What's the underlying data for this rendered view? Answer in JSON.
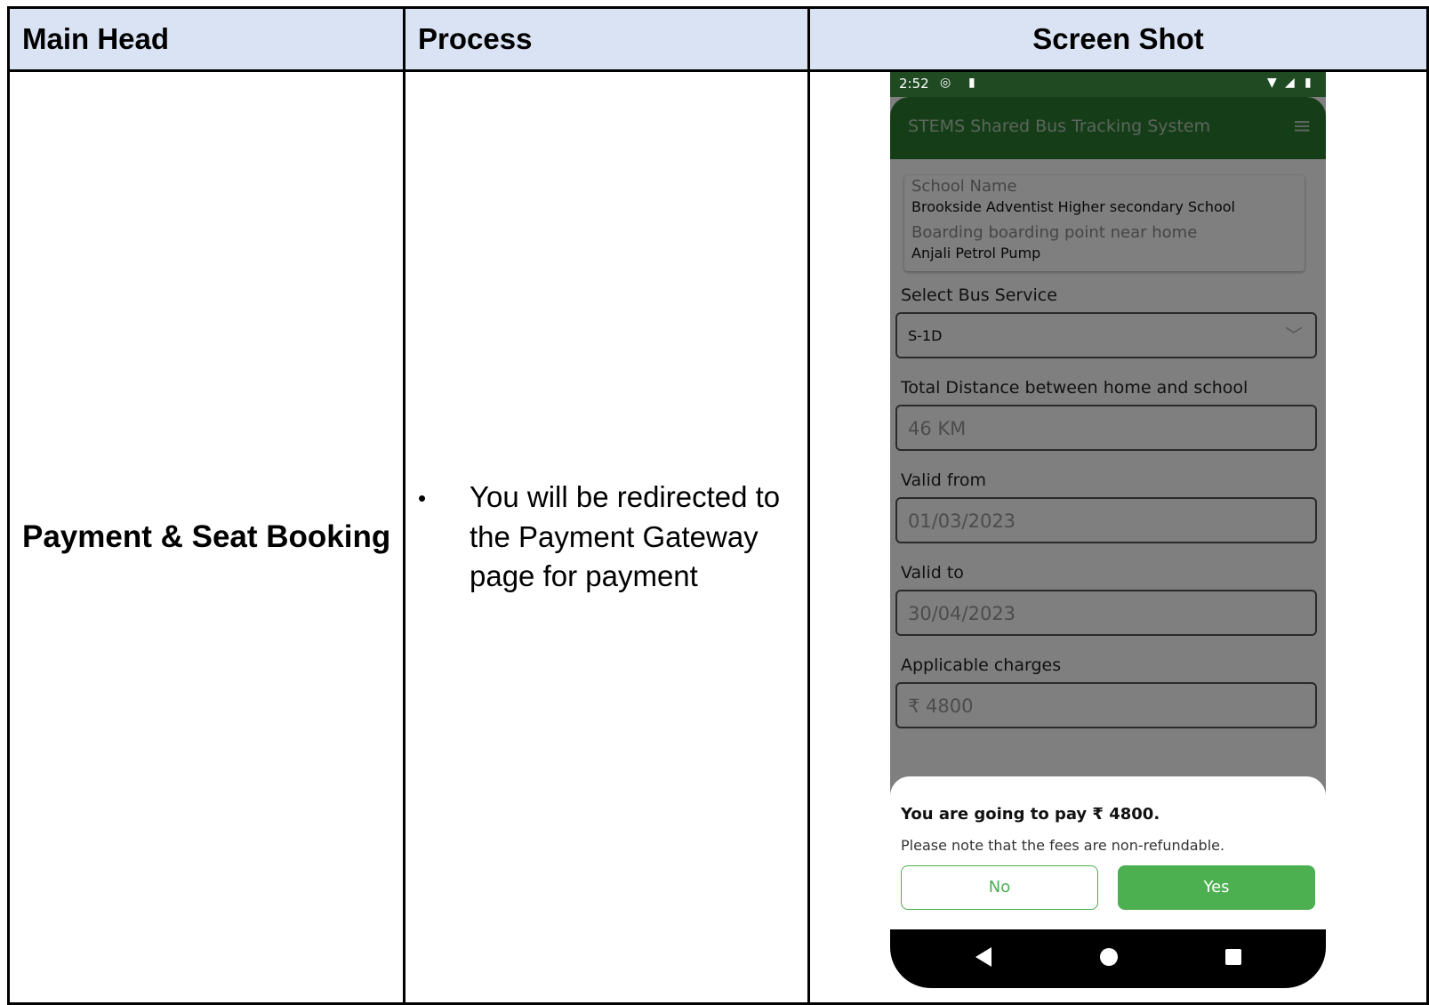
{
  "table": {
    "headers": [
      "Main Head",
      "Process",
      "Screen Shot"
    ],
    "row": {
      "main_head": "Payment & Seat Booking",
      "process_items": [
        "You will be redirected to the Payment Gateway page for payment"
      ],
      "bullet": "•"
    }
  },
  "phone": {
    "status": {
      "time": "2:52"
    },
    "appbar": {
      "title": "STEMS Shared Bus Tracking System"
    },
    "info_card": {
      "school_label": "School Name",
      "school_value": "Brookside Adventist Higher secondary School",
      "boarding_label": "Boarding boarding point near home",
      "boarding_value": "Anjali Petrol Pump"
    },
    "form": {
      "bus_service_label": "Select Bus Service",
      "bus_service_value": "S-1D",
      "distance_label": "Total Distance between home and school",
      "distance_value": "46 KM",
      "valid_from_label": "Valid from",
      "valid_from_value": "01/03/2023",
      "valid_to_label": "Valid to",
      "valid_to_value": "30/04/2023",
      "charges_label": "Applicable charges",
      "charges_value": "₹ 4800"
    },
    "dialog": {
      "message": "You are going to pay ₹ 4800.",
      "note": "Please note that the fees are non-refundable.",
      "no_label": "No",
      "yes_label": "Yes"
    },
    "colors": {
      "appbar": "#2b7a31",
      "accent": "#4caf50",
      "header_bg": "#dae3f3"
    },
    "icons": [
      "hamburger-menu-icon",
      "wifi-icon",
      "signal-icon",
      "battery-icon",
      "back-nav-icon",
      "home-nav-icon",
      "recents-nav-icon"
    ]
  }
}
